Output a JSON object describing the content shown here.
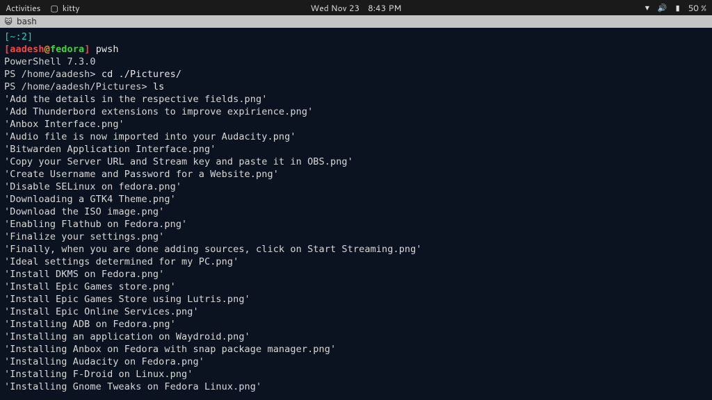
{
  "topbar": {
    "activities": "Activities",
    "app_icon": "▢",
    "app_name": "kitty",
    "date": "Wed Nov 23",
    "time": "8:43 PM",
    "battery_pct": "50 %"
  },
  "tabbar": {
    "tab_icon": "😺",
    "tab_title": "bash"
  },
  "prompt1": {
    "open": "[",
    "tilde": "~",
    "colon": ":",
    "num": "2",
    "close": "]"
  },
  "prompt2": {
    "open": "[",
    "user": "aadesh",
    "at": "@",
    "host": "fedora",
    "close": "]",
    "cmd": "pwsh"
  },
  "lines": {
    "psver": "PowerShell 7.3.0",
    "ps1_prompt": "PS /home/aadesh> ",
    "ps1_cmd": "cd ./Pictures/",
    "ps2_prompt": "PS /home/aadesh/Pictures> ",
    "ps2_cmd": "ls"
  },
  "ls": [
    "'Add the details in the respective fields.png'",
    "'Add Thunderbord extensions to improve expirience.png'",
    "'Anbox Interface.png'",
    "'Audio file is now imported into your Audacity.png'",
    "'Bitwarden Application Interface.png'",
    "'Copy your Server URL and Stream key and paste it in OBS.png'",
    "'Create Username and Password for a Website.png'",
    "'Disable SELinux on fedora.png'",
    "'Downloading a GTK4 Theme.png'",
    "'Download the ISO image.png'",
    "'Enabling Flathub on Fedora.png'",
    "'Finalize your settings.png'",
    "'Finally, when you are done adding sources, click on Start Streaming.png'",
    "'Ideal settings determined for my PC.png'",
    "'Install DKMS on Fedora.png'",
    "'Install Epic Games store.png'",
    "'Install Epic Games Store using Lutris.png'",
    "'Install Epic Online Services.png'",
    "'Installing ADB on Fedora.png'",
    "'Installing an application on Waydroid.png'",
    "'Installing Anbox on Fedora with snap package manager.png'",
    "'Installing Audacity on Fedora.png'",
    "'Installing F-Droid on Linux.png'",
    "'Installing Gnome Tweaks on Fedora Linux.png'"
  ]
}
